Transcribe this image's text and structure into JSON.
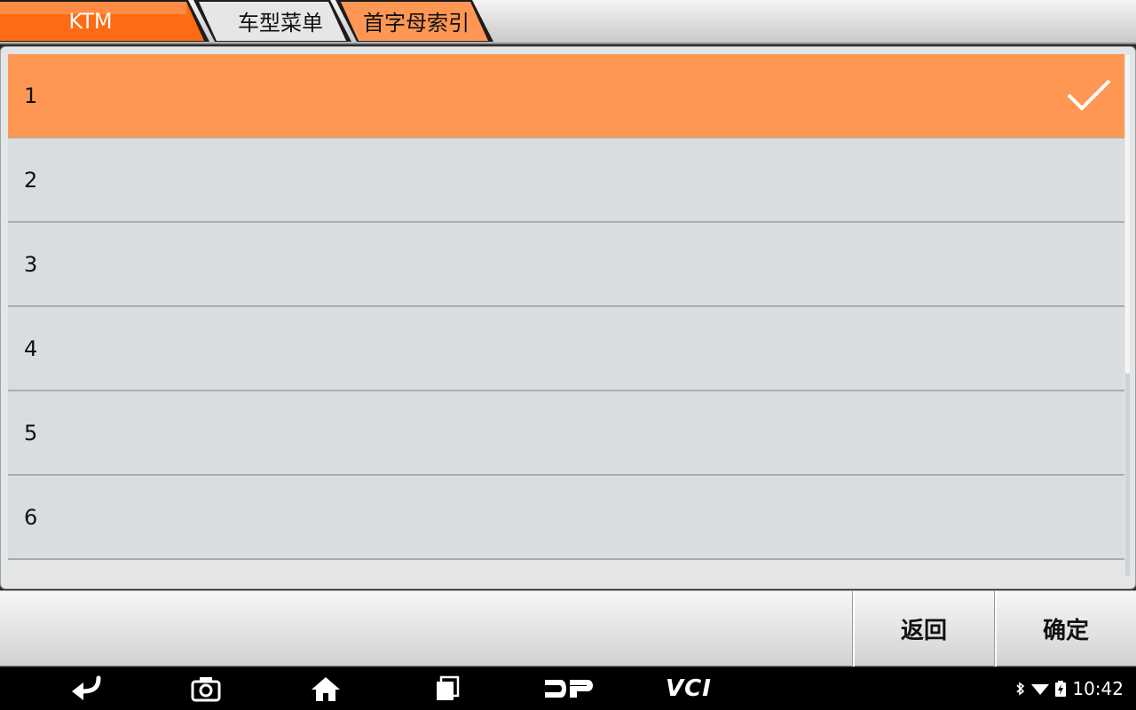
{
  "breadcrumb": {
    "brand": "KTM",
    "menu": "车型菜单",
    "index": "首字母索引"
  },
  "list": {
    "items": [
      {
        "label": "1",
        "selected": true
      },
      {
        "label": "2",
        "selected": false
      },
      {
        "label": "3",
        "selected": false
      },
      {
        "label": "4",
        "selected": false
      },
      {
        "label": "5",
        "selected": false
      },
      {
        "label": "6",
        "selected": false
      }
    ]
  },
  "buttons": {
    "back": "返回",
    "confirm": "确定"
  },
  "navbar": {
    "icons": [
      "back-arrow-icon",
      "camera-icon",
      "home-icon",
      "recent-apps-icon",
      "dp-logo-icon",
      "vci-icon"
    ],
    "vci_label": "VCI"
  },
  "status": {
    "time": "10:42",
    "icons": [
      "bluetooth-icon",
      "wifi-icon",
      "battery-charging-icon"
    ]
  },
  "colors": {
    "accent": "#ff9754",
    "crumb_active": "#ff6a14",
    "row_bg": "#dadddf"
  }
}
